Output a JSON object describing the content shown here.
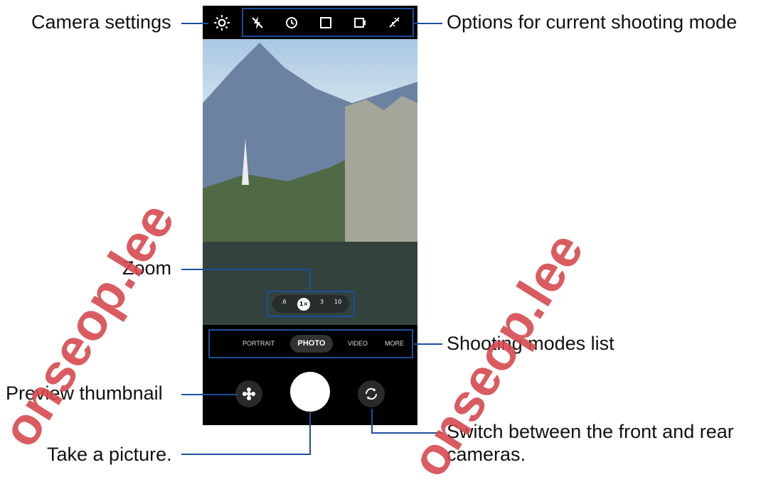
{
  "callouts": {
    "camera_settings": "Camera settings",
    "options": "Options for current shooting mode",
    "zoom": "Zoom",
    "modes_list": "Shooting modes list",
    "preview": "Preview thumbnail",
    "take_picture": "Take a picture.",
    "switch_line1": "Switch between the front and rear",
    "switch_line2": "cameras."
  },
  "camera_ui": {
    "zoom_levels": [
      ".6",
      "1×",
      "3",
      "10"
    ],
    "modes": [
      "PORTRAIT",
      "PHOTO",
      "VIDEO",
      "MORE"
    ],
    "selected_mode": "PHOTO"
  },
  "watermark": {
    "left": "onseop.lee",
    "right": "onseop.lee"
  },
  "colors": {
    "callout_line": "#1d4f9c",
    "watermark": "#d6494f"
  }
}
